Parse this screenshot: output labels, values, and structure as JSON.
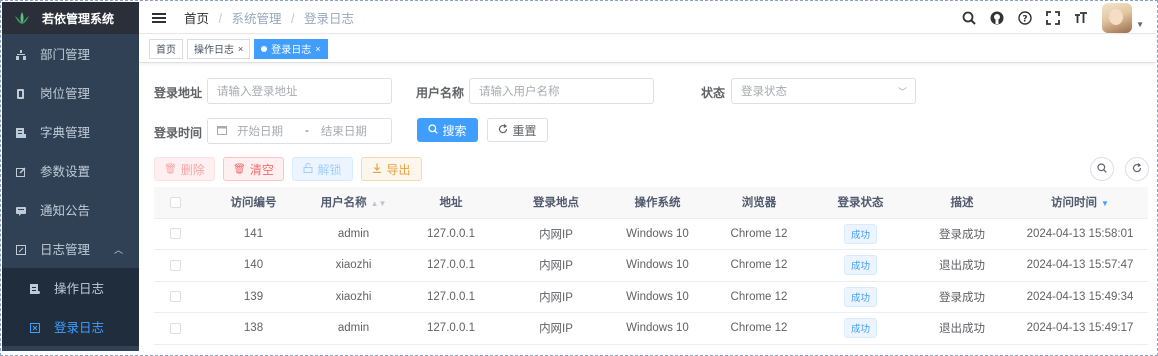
{
  "app": {
    "title": "若依管理系统"
  },
  "sidebar": {
    "items": [
      {
        "label": "部门管理",
        "icon": "tree-icon"
      },
      {
        "label": "岗位管理",
        "icon": "post-icon"
      },
      {
        "label": "字典管理",
        "icon": "dict-icon"
      },
      {
        "label": "参数设置",
        "icon": "edit-icon"
      },
      {
        "label": "通知公告",
        "icon": "message-icon"
      },
      {
        "label": "日志管理",
        "icon": "log-icon"
      },
      {
        "label": "操作日志",
        "icon": "form-icon"
      },
      {
        "label": "登录日志",
        "icon": "logininfor-icon"
      }
    ]
  },
  "breadcrumb": {
    "home": "首页",
    "sep": "/",
    "parent": "系统管理",
    "current": "登录日志"
  },
  "tags": [
    {
      "label": "首页"
    },
    {
      "label": "操作日志",
      "close": "×"
    },
    {
      "label": "登录日志",
      "close": "×"
    }
  ],
  "search": {
    "ipaddr_label": "登录地址",
    "ipaddr_placeholder": "请输入登录地址",
    "username_label": "用户名称",
    "username_placeholder": "请输入用户名称",
    "status_label": "状态",
    "status_placeholder": "登录状态",
    "time_label": "登录时间",
    "start_placeholder": "开始日期",
    "range_sep": "-",
    "end_placeholder": "结束日期",
    "search_button": "搜索",
    "reset_button": "重置"
  },
  "toolbar": {
    "delete_button": "删除",
    "clean_button": "清空",
    "unlock_button": "解锁",
    "export_button": "导出"
  },
  "table": {
    "columns": [
      "访问编号",
      "用户名称",
      "地址",
      "登录地点",
      "操作系统",
      "浏览器",
      "登录状态",
      "描述",
      "访问时间"
    ],
    "rows": [
      [
        "141",
        "admin",
        "127.0.0.1",
        "内网IP",
        "Windows 10",
        "Chrome 12",
        "成功",
        "登录成功",
        "2024-04-13 15:58:01"
      ],
      [
        "140",
        "xiaozhi",
        "127.0.0.1",
        "内网IP",
        "Windows 10",
        "Chrome 12",
        "成功",
        "退出成功",
        "2024-04-13 15:57:47"
      ],
      [
        "139",
        "xiaozhi",
        "127.0.0.1",
        "内网IP",
        "Windows 10",
        "Chrome 12",
        "成功",
        "登录成功",
        "2024-04-13 15:49:34"
      ],
      [
        "138",
        "admin",
        "127.0.0.1",
        "内网IP",
        "Windows 10",
        "Chrome 12",
        "成功",
        "退出成功",
        "2024-04-13 15:49:17"
      ]
    ]
  },
  "colors": {
    "sidebar_bg": "#304156",
    "accent": "#409eff"
  }
}
